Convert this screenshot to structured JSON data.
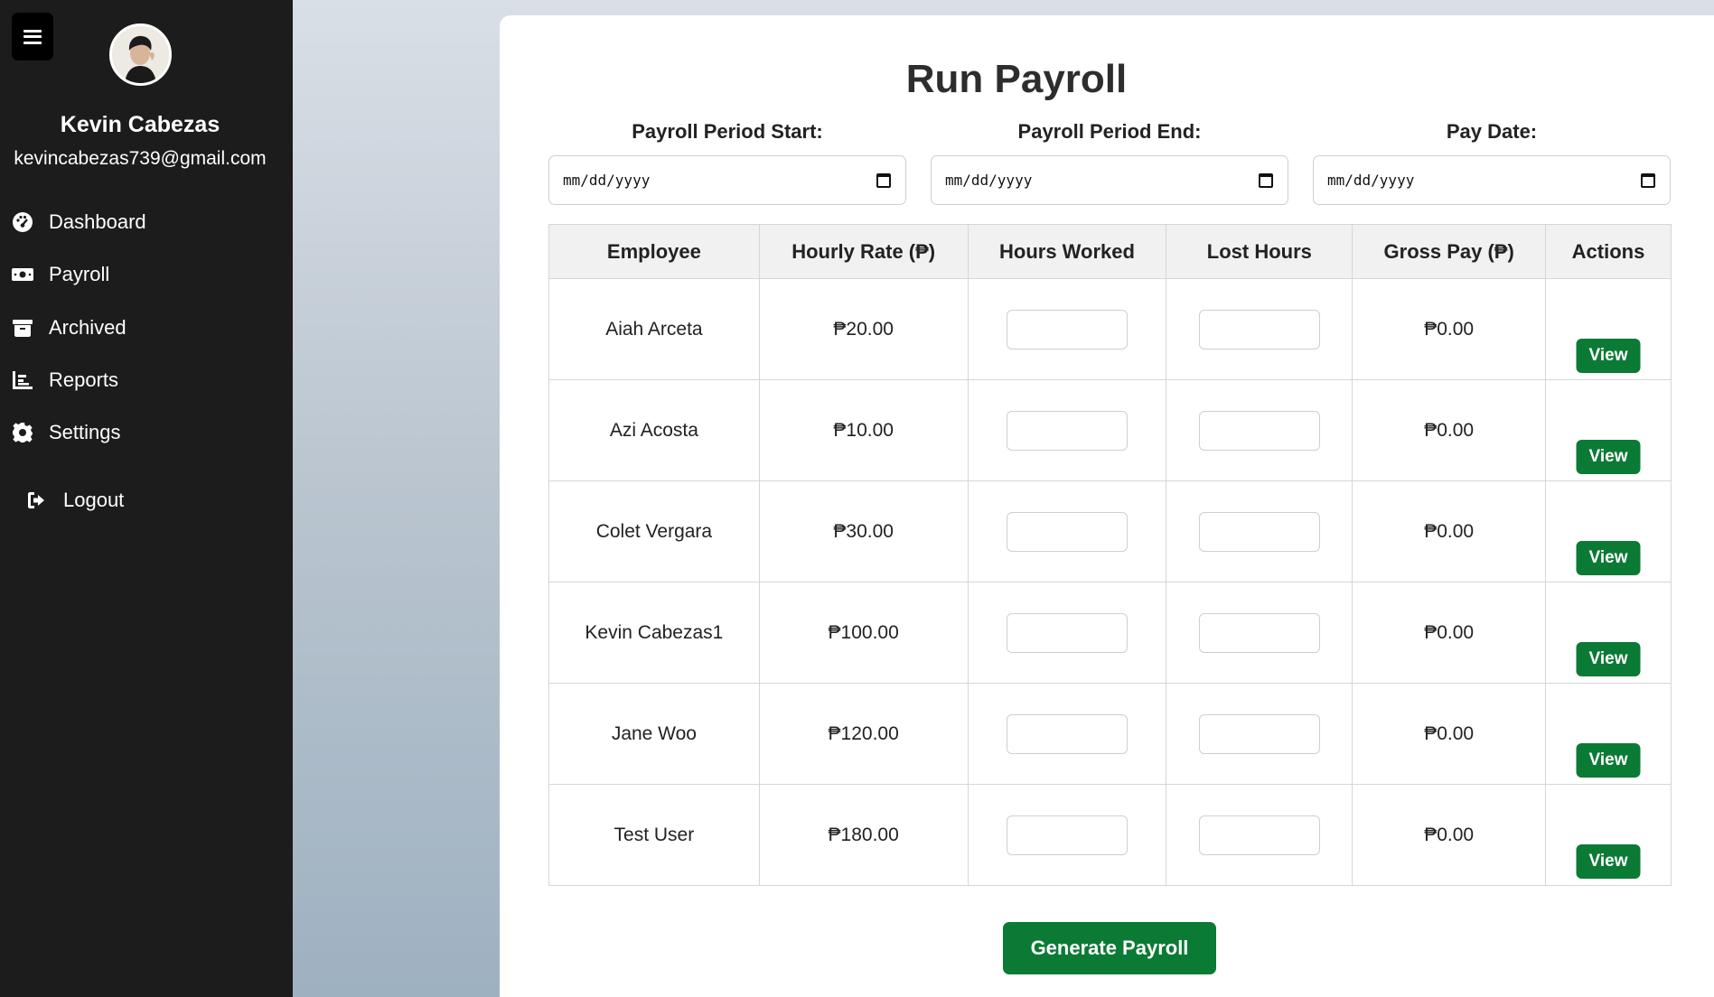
{
  "sidebar": {
    "menu_icon": "hamburger-icon",
    "profile": {
      "name": "Kevin Cabezas",
      "email": "kevincabezas739@gmail.com"
    },
    "items": [
      {
        "label": "Dashboard",
        "icon": "dashboard-gauge-icon"
      },
      {
        "label": "Payroll",
        "icon": "money-bill-icon"
      },
      {
        "label": "Archived",
        "icon": "archive-box-icon"
      },
      {
        "label": "Reports",
        "icon": "bar-chart-icon"
      },
      {
        "label": "Settings",
        "icon": "gear-icon"
      },
      {
        "label": "Logout",
        "icon": "logout-icon"
      }
    ]
  },
  "main": {
    "title": "Run Payroll",
    "dates": [
      {
        "label": "Payroll Period Start:",
        "placeholder": "mm/dd/yyyy"
      },
      {
        "label": "Payroll Period End:",
        "placeholder": "mm/dd/yyyy"
      },
      {
        "label": "Pay Date:",
        "placeholder": "mm/dd/yyyy"
      }
    ],
    "table": {
      "headers": [
        "Employee",
        "Hourly Rate (₱)",
        "Hours Worked",
        "Lost Hours",
        "Gross Pay (₱)",
        "Actions"
      ],
      "rows": [
        {
          "employee": "Aiah Arceta",
          "rate": "₱20.00",
          "gross": "₱0.00",
          "action": "View"
        },
        {
          "employee": "Azi Acosta",
          "rate": "₱10.00",
          "gross": "₱0.00",
          "action": "View"
        },
        {
          "employee": "Colet Vergara",
          "rate": "₱30.00",
          "gross": "₱0.00",
          "action": "View"
        },
        {
          "employee": "Kevin Cabezas1",
          "rate": "₱100.00",
          "gross": "₱0.00",
          "action": "View"
        },
        {
          "employee": "Jane Woo",
          "rate": "₱120.00",
          "gross": "₱0.00",
          "action": "View"
        },
        {
          "employee": "Test User",
          "rate": "₱180.00",
          "gross": "₱0.00",
          "action": "View"
        }
      ]
    },
    "generate_label": "Generate Payroll"
  },
  "colors": {
    "sidebar_bg": "#1c1c1c",
    "accent_green": "#0b7a34"
  }
}
